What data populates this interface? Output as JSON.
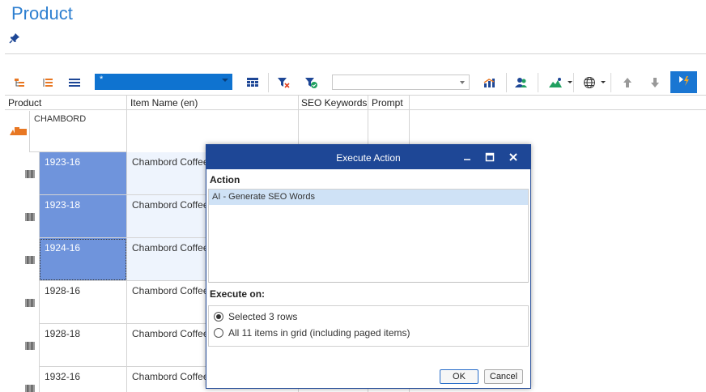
{
  "page": {
    "title": "Product"
  },
  "toolbar": {
    "view_value": "*",
    "search_value": "",
    "icons": [
      "tree-view-icon",
      "indent-icon",
      "list-icon",
      "columns-icon",
      "clear-filter-icon",
      "filter-apply-icon",
      "chart-icon",
      "users-icon",
      "image-icon",
      "globe-icon",
      "arrow-up-icon",
      "arrow-down-icon",
      "execute-action-icon"
    ],
    "accent": "#1a76d2"
  },
  "grid": {
    "columns": [
      "Product",
      "Item Name (en)",
      "SEO Keywords",
      "Prompt"
    ],
    "group": {
      "label": "CHAMBORD"
    },
    "rows": [
      {
        "product": "1923-16",
        "item_name": "Chambord Coffee",
        "selected": true
      },
      {
        "product": "1923-18",
        "item_name": "Chambord Coffee",
        "selected": true
      },
      {
        "product": "1924-16",
        "item_name": "Chambord Coffee",
        "selected": true
      },
      {
        "product": "1928-16",
        "item_name": "Chambord Coffee",
        "selected": false
      },
      {
        "product": "1928-18",
        "item_name": "Chambord Coffee",
        "selected": false
      },
      {
        "product": "1932-16",
        "item_name": "Chambord Coffee",
        "selected": false
      }
    ],
    "selection_color": "#6f94dc"
  },
  "dialog": {
    "title": "Execute Action",
    "action_header": "Action",
    "actions": [
      "AI - Generate SEO Words"
    ],
    "execute_on_header": "Execute on:",
    "options": [
      {
        "label": "Selected 3 rows",
        "checked": true
      },
      {
        "label": "All 11 items in grid (including paged items)",
        "checked": false
      }
    ],
    "ok_label": "OK",
    "cancel_label": "Cancel",
    "title_bar_color": "#1e4796"
  }
}
